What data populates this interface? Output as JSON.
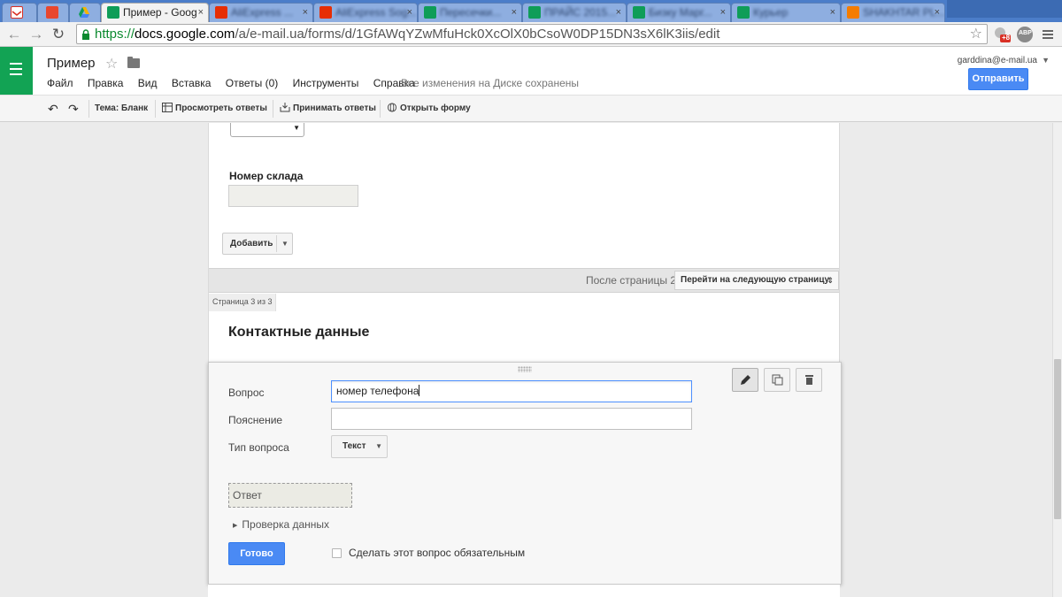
{
  "browser": {
    "tabs": [
      {
        "title": "",
        "favicon": "gmail-icon",
        "color": "#d93025"
      },
      {
        "title": "",
        "favicon": "red-square-icon",
        "color": "#e8472e"
      },
      {
        "title": "",
        "favicon": "drive-icon",
        "color": "#f4b400"
      },
      {
        "title": "Пример - Goog",
        "favicon": "forms-icon",
        "color": "#0f9d58"
      },
      {
        "title": "AliExpress ...",
        "favicon": "aliexpress-icon",
        "color": "#e62e04"
      },
      {
        "title": "AliExpress Sog...",
        "favicon": "aliexpress-icon",
        "color": "#e62e04"
      },
      {
        "title": "Пересечки...",
        "favicon": "sheets-icon",
        "color": "#0f9d58"
      },
      {
        "title": "ПРАЙС 2015...",
        "favicon": "sheets-icon",
        "color": "#0f9d58"
      },
      {
        "title": "Бизку Марг...",
        "favicon": "sheets-icon",
        "color": "#0f9d58"
      },
      {
        "title": "Курьер",
        "favicon": "sheets-icon",
        "color": "#0f9d58"
      },
      {
        "title": "SHAKHTAR PL...",
        "favicon": "shakhtar-icon",
        "color": "#f57c00"
      }
    ],
    "url": {
      "protocol": "https://",
      "host": "docs.google.com",
      "path": "/a/e-mail.ua/forms/d/1GfAWqYZwMfuHck0XcOlX0bCsoW0DP15DN3sX6lK3iis/edit"
    },
    "ext_badge": "+8",
    "abp_label": "ABP"
  },
  "header": {
    "doc_title": "Пример",
    "menu": [
      "Файл",
      "Правка",
      "Вид",
      "Вставка",
      "Ответы (0)",
      "Инструменты",
      "Справка"
    ],
    "saved_message": "Все изменения на Диске сохранены",
    "account": "garddina@e-mail.ua",
    "send_label": "Отправить"
  },
  "form_toolbar": {
    "theme": "Тема: Бланк",
    "view_responses": "Просмотреть ответы",
    "accept_responses": "Принимать ответы",
    "open_form": "Открыть форму"
  },
  "form": {
    "prev_dropdown_arrow": "▼",
    "warehouse_label": "Номер склада",
    "add_label": "Добавить",
    "after_page_label": "После страницы 2",
    "goto_label": "Перейти на следующую страницу",
    "page_indicator": "Страница 3 из 3",
    "section_title": "Контактные данные",
    "edit": {
      "question_label": "Вопрос",
      "question_value": "номер телефона",
      "help_label": "Пояснение",
      "help_value": "",
      "type_label": "Тип вопроса",
      "type_value": "Текст",
      "answer_placeholder": "Ответ",
      "validation_label": "Проверка данных",
      "done_label": "Готово",
      "required_label": "Сделать этот вопрос обязательным",
      "required_checked": false
    }
  },
  "colors": {
    "tabstrip": "#4b7dc9",
    "forms_green": "#12a354",
    "primary_button": "#4a8af4"
  }
}
